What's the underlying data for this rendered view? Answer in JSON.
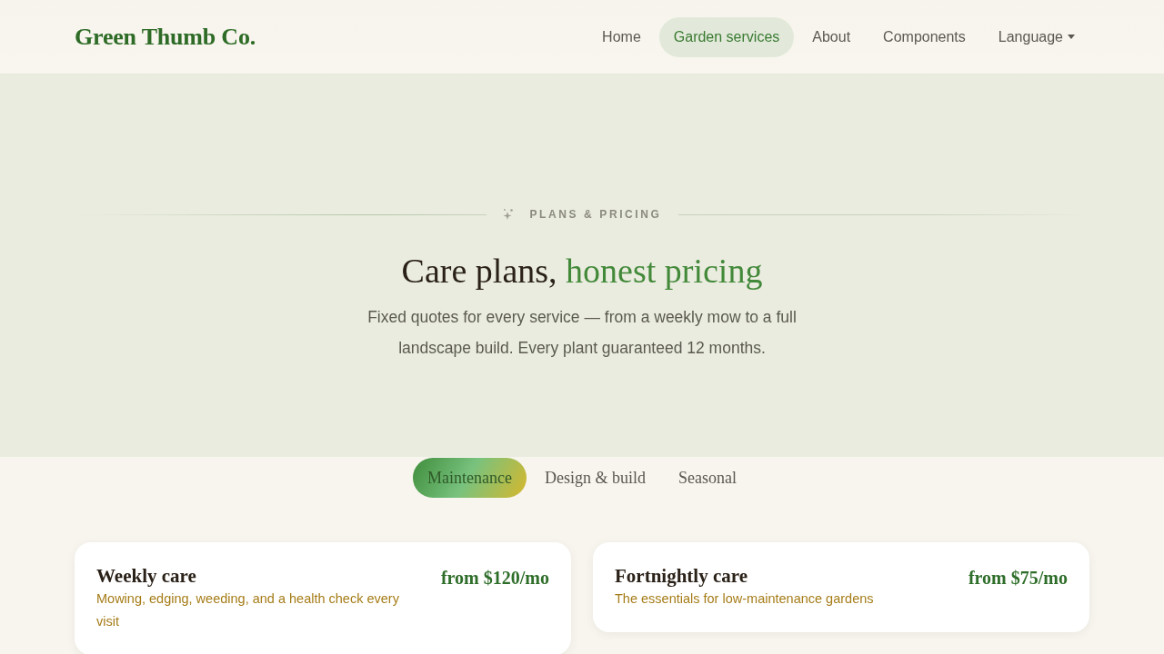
{
  "navbar": {
    "brand": "Green Thumb Co.",
    "links": [
      {
        "label": "Home",
        "selected": false,
        "kind": "link"
      },
      {
        "label": "Garden services",
        "selected": true,
        "kind": "link"
      },
      {
        "label": "About",
        "selected": false,
        "kind": "link"
      },
      {
        "label": "Components",
        "selected": false,
        "kind": "link"
      },
      {
        "label": "Language",
        "selected": false,
        "kind": "dropdown"
      }
    ]
  },
  "hero": {
    "eyebrow": "PLANS & PRICING",
    "title": "Care plans,",
    "title_highlight": "honest pricing",
    "subtitle": "Fixed quotes for every service — from a weekly mow to a full landscape build. Every plant guaranteed 12 months."
  },
  "tabs": [
    {
      "label": "Maintenance",
      "selected": true
    },
    {
      "label": "Design & build",
      "selected": false
    },
    {
      "label": "Seasonal",
      "selected": false
    }
  ],
  "plans": [
    {
      "name": "Weekly care",
      "description": "Mowing, edging, weeding, and a health check every visit",
      "price": "from $120/mo"
    },
    {
      "name": "Fortnightly care",
      "description": "The essentials for low-maintenance gardens",
      "price": "from $75/mo"
    }
  ]
}
